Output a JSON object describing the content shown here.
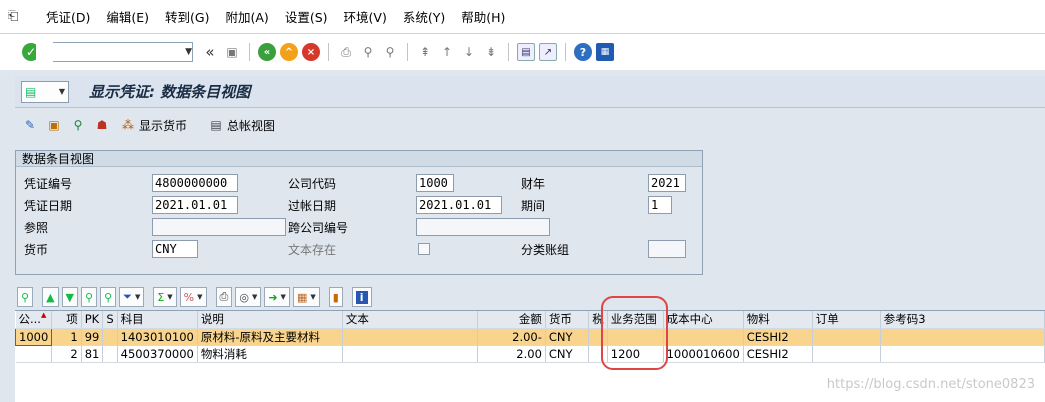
{
  "menu": {
    "items": [
      "凭证(D)",
      "编辑(E)",
      "转到(G)",
      "附加(A)",
      "设置(S)",
      "环境(V)",
      "系统(Y)",
      "帮助(H)"
    ]
  },
  "toolbar": {
    "command_value": "",
    "back_glyph": "«"
  },
  "title": {
    "text": "显示凭证: 数据条目视图"
  },
  "app_toolbar": {
    "display_currency": "显示货币",
    "general_ledger_view": "总帐视图"
  },
  "header_group": {
    "title": "数据条目视图",
    "fields": {
      "doc_number_label": "凭证编号",
      "doc_number": "4800000000",
      "company_code_label": "公司代码",
      "company_code": "1000",
      "fiscal_year_label": "财年",
      "fiscal_year": "2021",
      "doc_date_label": "凭证日期",
      "doc_date": "2021.01.01",
      "posting_date_label": "过帐日期",
      "posting_date": "2021.01.01",
      "period_label": "期间",
      "period": "1",
      "reference_label": "参照",
      "reference": "",
      "cross_company_label": "跨公司编号",
      "cross_company": "",
      "currency_label": "货币",
      "currency": "CNY",
      "text_exists_label": "文本存在",
      "ledger_group_label": "分类账组",
      "ledger_group": ""
    }
  },
  "grid": {
    "columns": [
      "公...",
      "项",
      "PK",
      "S",
      "科目",
      "说明",
      "文本",
      "金额",
      "货币",
      "税",
      "业务范围",
      "成本中心",
      "物料",
      "订单",
      "参考码3"
    ],
    "rows": [
      {
        "company": "1000",
        "item": "1",
        "pk": "99",
        "s": "",
        "account": "1403010100",
        "description": "原材料-原料及主要材料",
        "text": "",
        "amount": "2.00-",
        "currency": "CNY",
        "tax": "",
        "business_area": "",
        "cost_center": "",
        "material": "CESHI2",
        "order": "",
        "ref3": ""
      },
      {
        "company": "",
        "item": "2",
        "pk": "81",
        "s": "",
        "account": "4500370000",
        "description": "物料消耗",
        "text": "",
        "amount": "2.00",
        "currency": "CNY",
        "tax": "",
        "business_area": "1200",
        "cost_center": "1000010600",
        "material": "CESHI2",
        "order": "",
        "ref3": ""
      }
    ]
  },
  "watermark": "https://blog.csdn.net/stone0823"
}
